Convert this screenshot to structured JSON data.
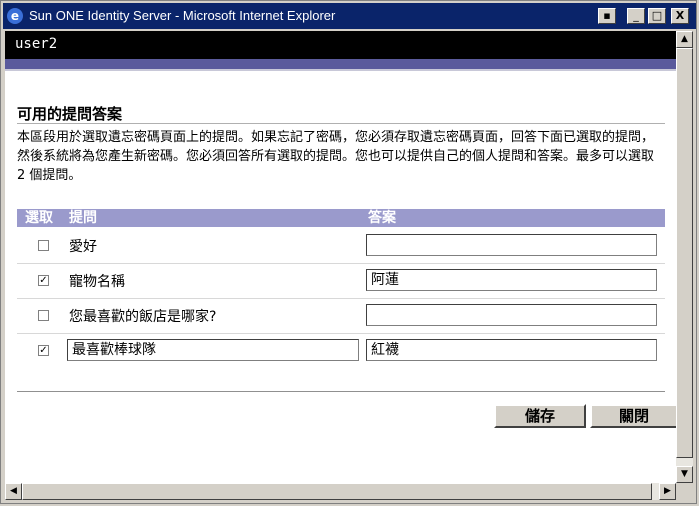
{
  "window": {
    "title": "Sun ONE Identity Server - Microsoft Internet Explorer",
    "controls": {
      "special": "▪",
      "minimize": "_",
      "maximize": "□",
      "close": "X"
    }
  },
  "header": {
    "username": "user2"
  },
  "section": {
    "title": "可用的提問答案",
    "description": "本區段用於選取遺忘密碼頁面上的提問。如果忘記了密碼，您必須存取遺忘密碼頁面，回答下面已選取的提問，然後系統將為您產生新密碼。您必須回答所有選取的提問。您也可以提供自己的個人提問和答案。最多可以選取 2 個提問。"
  },
  "table": {
    "headers": {
      "select": "選取",
      "question": "提問",
      "answer": "答案"
    },
    "rows": [
      {
        "checked": false,
        "check_mark": "",
        "question": "愛好",
        "answer": ""
      },
      {
        "checked": true,
        "check_mark": "✓",
        "question": "寵物名稱",
        "answer": "阿蓮"
      },
      {
        "checked": false,
        "check_mark": "",
        "question": "您最喜歡的飯店是哪家?",
        "answer": ""
      },
      {
        "checked": true,
        "check_mark": "✓",
        "question": "最喜歡棒球隊",
        "answer": "紅襪",
        "custom": true
      }
    ]
  },
  "buttons": {
    "save": "儲存",
    "close": "關閉"
  },
  "colors": {
    "titlebar": "#0a246a",
    "header_bg": "#000000",
    "accent_bar": "#5a5a9c",
    "table_header": "#9a9acc"
  }
}
